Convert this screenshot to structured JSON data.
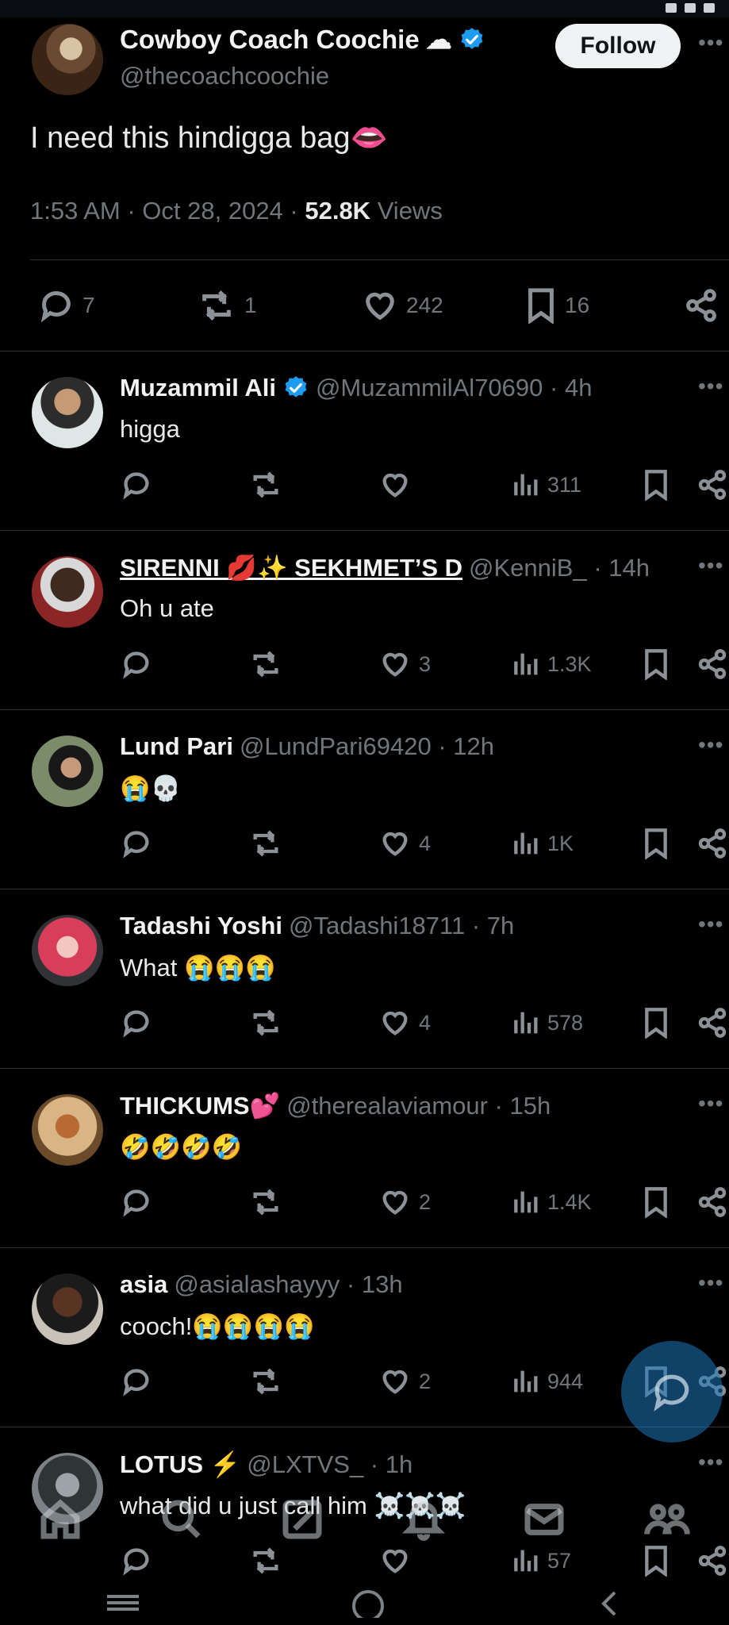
{
  "main_tweet": {
    "name": "Cowboy Coach Coochie",
    "handle": "@thecoachcoochie",
    "follow_label": "Follow",
    "text": "I need this hindigga bag👄",
    "time": "1:53 AM · Oct 28, 2024 · ",
    "views_count": "52.8K",
    "views_label": " Views",
    "replies": "7",
    "reposts": "1",
    "likes": "242",
    "bookmarks": "16"
  },
  "replies": [
    {
      "name": "Muzammil Ali",
      "verified": true,
      "handle": "@MuzammilAl70690 · 4h",
      "text": "higga",
      "likes": "",
      "views": "311"
    },
    {
      "name": "SIRENNI 💋✨ SEKHMET’S D",
      "verified": false,
      "handle": "@KenniB_ · 14h",
      "text": "Oh u ate",
      "likes": "3",
      "views": "1.3K"
    },
    {
      "name": "Lund Pari",
      "verified": false,
      "handle": "@LundPari69420 · 12h",
      "text": "😭💀",
      "likes": "4",
      "views": "1K"
    },
    {
      "name": "Tadashi Yoshi",
      "verified": false,
      "handle": "@Tadashi18711 · 7h",
      "text": "What 😭😭😭",
      "likes": "4",
      "views": "578"
    },
    {
      "name": "THICKUMS💕",
      "verified": false,
      "handle": "@therealaviamour · 15h",
      "text": "🤣🤣🤣🤣",
      "likes": "2",
      "views": "1.4K"
    },
    {
      "name": "asia",
      "verified": false,
      "handle": "@asialashayyy · 13h",
      "text": "cooch!😭😭😭😭",
      "likes": "2",
      "views": "944"
    },
    {
      "name": "LOTUS ⚡",
      "verified": false,
      "handle": "@LXTVS_ · 1h",
      "text": "what did u just call him ☠️☠️☠️",
      "likes": "",
      "views": "57"
    }
  ],
  "icons": {
    "reply": "reply-icon",
    "repost": "repost-icon",
    "like": "heart-icon",
    "views": "views-icon",
    "bookmark": "bookmark-icon",
    "share": "share-icon",
    "more": "more-icon",
    "verified": "verified-badge-icon"
  },
  "colors": {
    "background": "#000000",
    "accent": "#1d9bf0",
    "muted": "#71767b"
  }
}
